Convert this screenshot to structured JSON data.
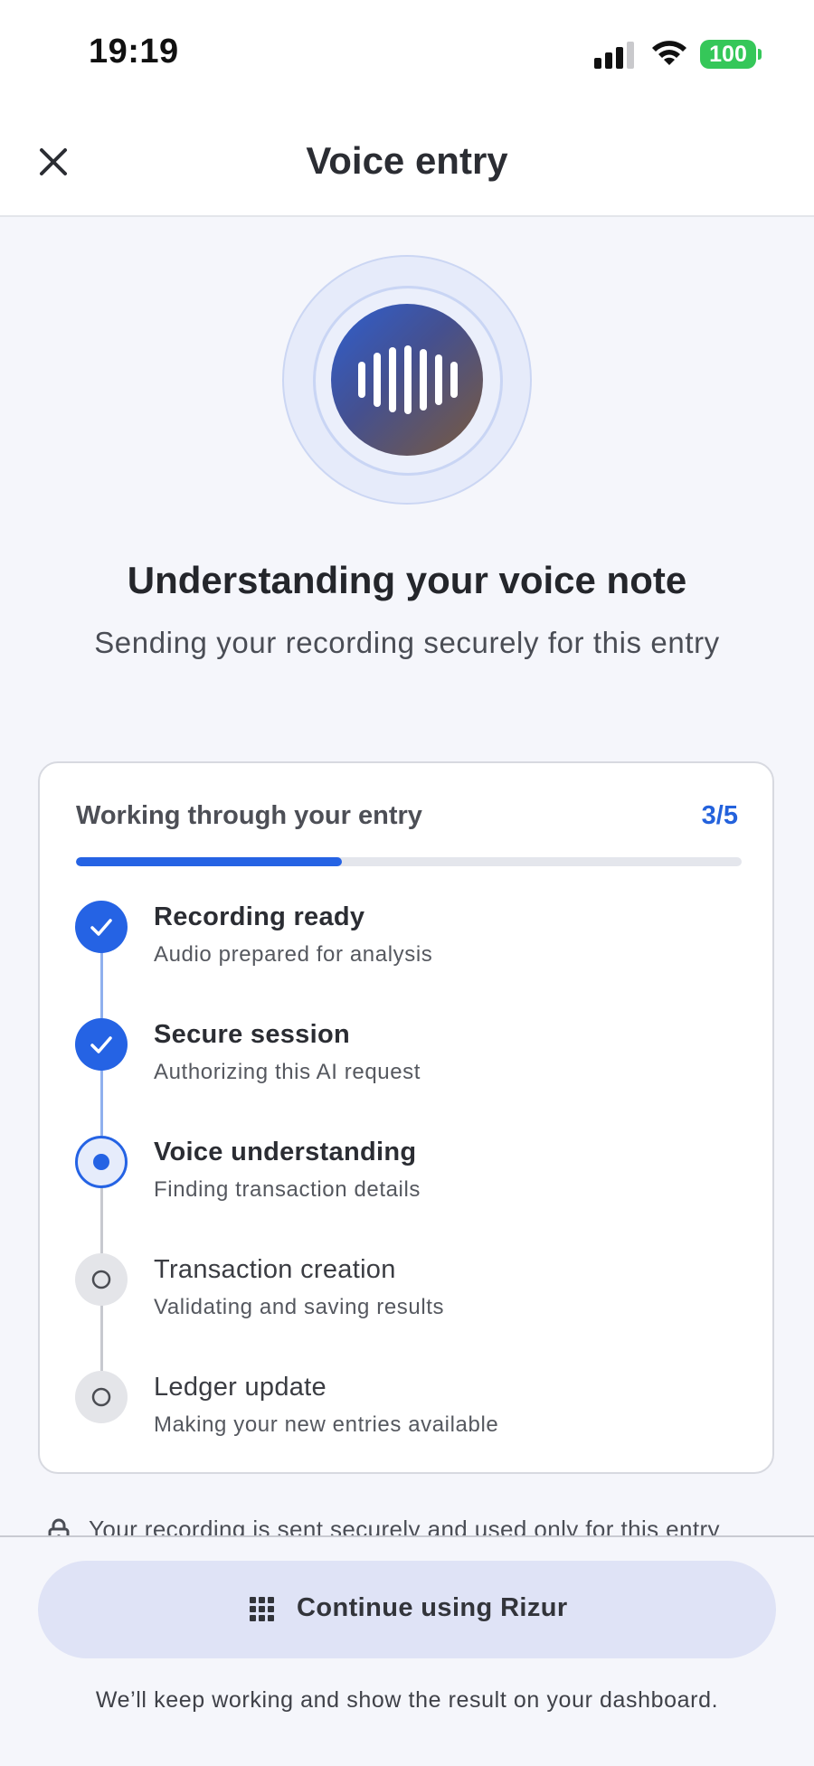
{
  "status_bar": {
    "time": "19:19",
    "battery": "100",
    "icons": [
      "cellular-signal-icon",
      "wifi-icon",
      "battery-icon"
    ]
  },
  "nav": {
    "title": "Voice entry",
    "close_icon": "close-icon"
  },
  "hero": {
    "icon": "sound-wave-icon",
    "title": "Understanding your voice note",
    "subtitle": "Sending your recording securely for this entry"
  },
  "progress": {
    "title": "Working through your entry",
    "count": "3/5",
    "fraction": 0.4,
    "steps": [
      {
        "title": "Recording ready",
        "description": "Audio prepared for analysis",
        "state": "done"
      },
      {
        "title": "Secure session",
        "description": "Authorizing this AI request",
        "state": "done"
      },
      {
        "title": "Voice understanding",
        "description": "Finding transaction details",
        "state": "active"
      },
      {
        "title": "Transaction creation",
        "description": "Validating and saving results",
        "state": "pending"
      },
      {
        "title": "Ledger update",
        "description": "Making your new entries available",
        "state": "pending"
      }
    ]
  },
  "security_note": "Your recording is sent securely and used only for this entry",
  "bottom": {
    "continue_label": "Continue using Rizur",
    "continue_icon": "grid-icon",
    "footer": "We’ll keep working and show the result on your dashboard."
  },
  "colors": {
    "accent": "#2563e4",
    "battery": "#35c759",
    "background": "#f5f6fb"
  }
}
